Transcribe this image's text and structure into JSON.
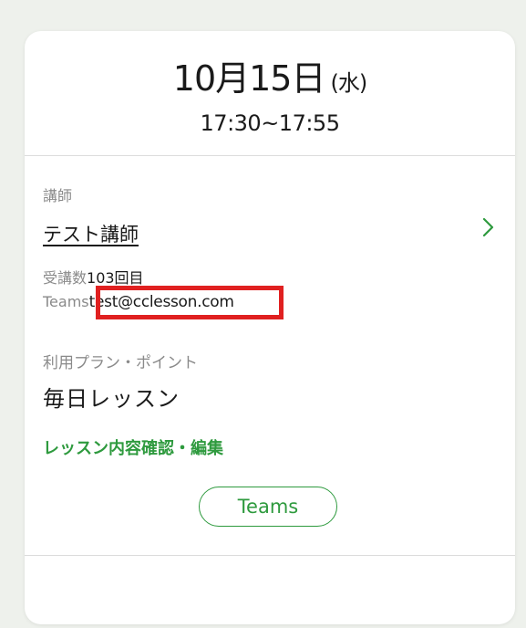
{
  "lesson": {
    "date": "10月15日",
    "weekday": "(水)",
    "time": "17:30~17:55"
  },
  "teacher": {
    "label": "講師",
    "name": "テスト講師"
  },
  "attendance": {
    "label": "受講数",
    "value": "103回目"
  },
  "teams": {
    "label": "Teams",
    "email": "test@cclesson.com"
  },
  "plan": {
    "label": "利用プラン・ポイント",
    "value": "毎日レッスン"
  },
  "actions": {
    "edit_link": "レッスン内容確認・編集",
    "teams_button": "Teams"
  },
  "icons": {
    "chevron": "chevron-right-icon"
  },
  "colors": {
    "accent_green": "#2e9a3e",
    "highlight_red": "#e02020",
    "background": "#eef1ec"
  }
}
